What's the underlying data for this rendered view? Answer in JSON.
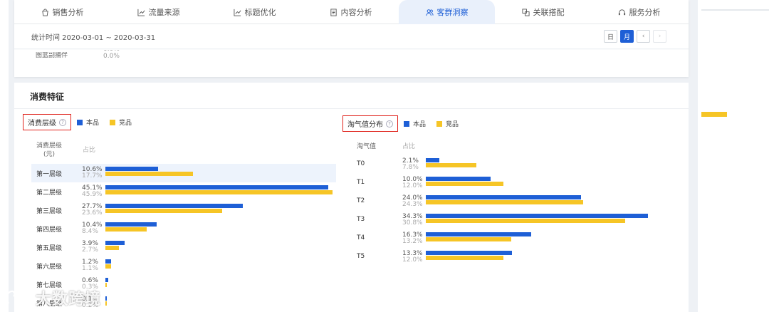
{
  "tabs": [
    {
      "label": "销售分析",
      "icon": "bag-icon",
      "active": false
    },
    {
      "label": "流量来源",
      "icon": "trend-icon",
      "active": false
    },
    {
      "label": "标题优化",
      "icon": "trend-icon",
      "active": false
    },
    {
      "label": "内容分析",
      "icon": "document-icon",
      "active": false
    },
    {
      "label": "客群洞察",
      "icon": "users-icon",
      "active": true
    },
    {
      "label": "关联搭配",
      "icon": "link-icon",
      "active": false
    },
    {
      "label": "服务分析",
      "icon": "headset-icon",
      "active": false
    }
  ],
  "date_range": "统计时间 2020-03-01 ~ 2020-03-31",
  "period_buttons": {
    "day": "日",
    "month": "月",
    "active": "月"
  },
  "nav_buttons": {
    "prev": "‹",
    "next": "›"
  },
  "partial_row": {
    "label": "图蓝副捕伴",
    "val1": "0.0%",
    "val2": "0.0%"
  },
  "section_title": "消费特征",
  "legend": {
    "own": "本品",
    "competitor": "竞品"
  },
  "colors": {
    "own": "#1e5fd6",
    "competitor": "#f6c526",
    "highlight": "#e0231c"
  },
  "left_panel": {
    "title": "消费层级",
    "col_label_line1": "消费层级",
    "col_label_line2": "(元)",
    "col_pct": "占比",
    "rows": [
      {
        "label": "第一层级",
        "own": "10.6%",
        "comp": "17.7%",
        "own_v": 10.6,
        "comp_v": 17.7
      },
      {
        "label": "第二层级",
        "own": "45.1%",
        "comp": "45.9%",
        "own_v": 45.1,
        "comp_v": 45.9
      },
      {
        "label": "第三层级",
        "own": "27.7%",
        "comp": "23.6%",
        "own_v": 27.7,
        "comp_v": 23.6
      },
      {
        "label": "第四层级",
        "own": "10.4%",
        "comp": "8.4%",
        "own_v": 10.4,
        "comp_v": 8.4
      },
      {
        "label": "第五层级",
        "own": "3.9%",
        "comp": "2.7%",
        "own_v": 3.9,
        "comp_v": 2.7
      },
      {
        "label": "第六层级",
        "own": "1.2%",
        "comp": "1.1%",
        "own_v": 1.2,
        "comp_v": 1.1
      },
      {
        "label": "第七层级",
        "own": "0.6%",
        "comp": "0.3%",
        "own_v": 0.6,
        "comp_v": 0.3
      },
      {
        "label": "第八层级",
        "own": "0.1%",
        "comp": "0.2%",
        "own_v": 0.1,
        "comp_v": 0.2
      }
    ]
  },
  "right_panel": {
    "title": "淘气值分布",
    "col_label": "淘气值",
    "col_pct": "占比",
    "rows": [
      {
        "label": "T0",
        "own": "2.1%",
        "comp": "7.8%",
        "own_v": 2.1,
        "comp_v": 7.8
      },
      {
        "label": "T1",
        "own": "10.0%",
        "comp": "12.0%",
        "own_v": 10.0,
        "comp_v": 12.0
      },
      {
        "label": "T2",
        "own": "24.0%",
        "comp": "24.3%",
        "own_v": 24.0,
        "comp_v": 24.3
      },
      {
        "label": "T3",
        "own": "34.3%",
        "comp": "30.8%",
        "own_v": 34.3,
        "comp_v": 30.8
      },
      {
        "label": "T4",
        "own": "16.3%",
        "comp": "13.2%",
        "own_v": 16.3,
        "comp_v": 13.2
      },
      {
        "label": "T5",
        "own": "13.3%",
        "comp": "12.0%",
        "own_v": 13.3,
        "comp_v": 12.0
      }
    ]
  },
  "watermark": "大数跨境"
}
